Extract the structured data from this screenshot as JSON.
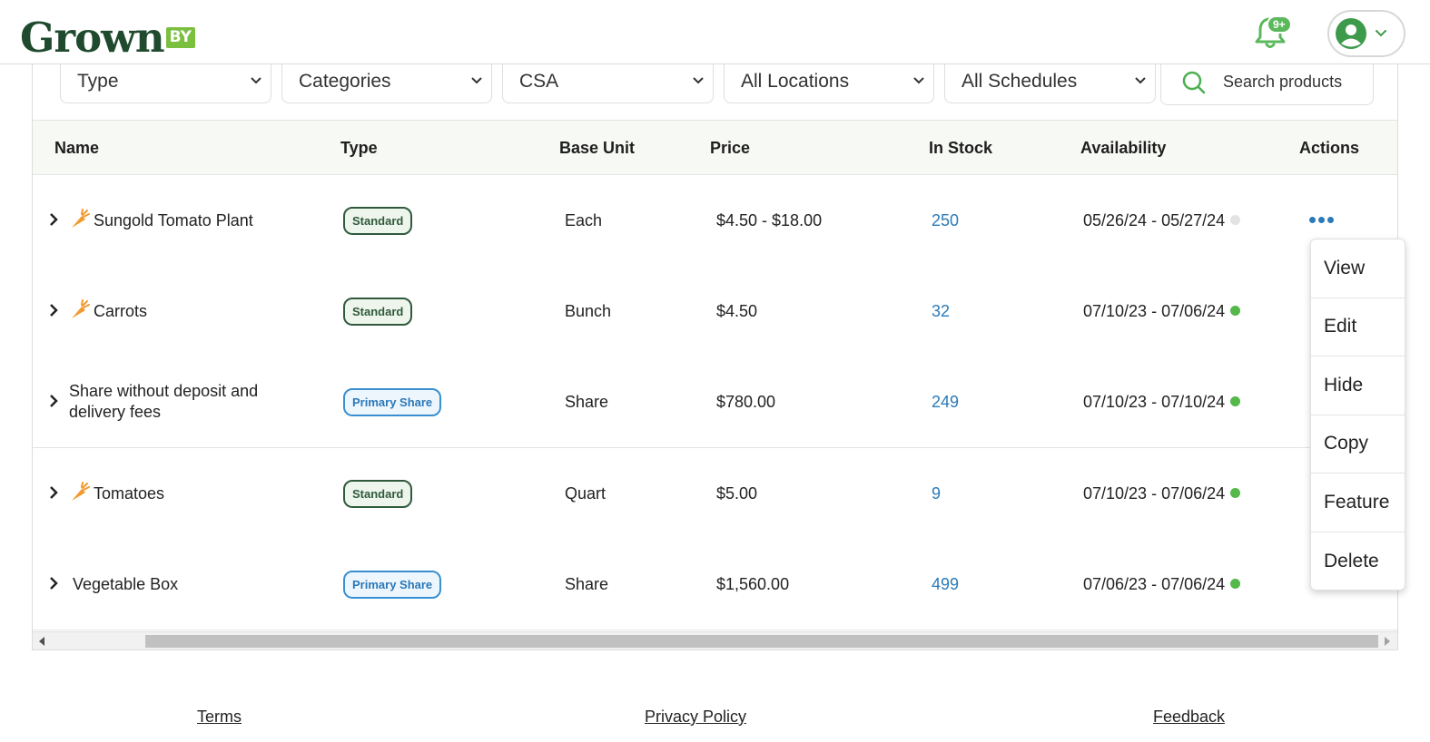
{
  "brand": {
    "logo_word": "Grown",
    "logo_suffix": "BY",
    "primary_color": "#1f4a2e",
    "accent_color": "#7bbf3f"
  },
  "header": {
    "notification_count": "9+",
    "bell_icon": "bell-icon",
    "user_icon": "user-avatar-icon"
  },
  "filters": {
    "type": "Type",
    "categories": "Categories",
    "csa": "CSA",
    "locations": "All Locations",
    "schedules": "All Schedules",
    "search_placeholder": "Search products"
  },
  "table": {
    "columns": [
      "Name",
      "Type",
      "Base Unit",
      "Price",
      "In Stock",
      "Availability",
      "Actions"
    ],
    "rows": [
      {
        "name": "Sungold Tomato Plant",
        "type": "Standard",
        "unit": "Each",
        "price": "$4.50 - $18.00",
        "stock": "250",
        "availability": "05/26/24 - 05/27/24",
        "status": "grey"
      },
      {
        "name": "Carrots",
        "type": "Standard",
        "unit": "Bunch",
        "price": "$4.50",
        "stock": "32",
        "availability": "07/10/23 - 07/06/24",
        "status": "green"
      },
      {
        "name": "Share without deposit and delivery fees",
        "type": "Primary Share",
        "unit": "Share",
        "price": "$780.00",
        "stock": "249",
        "availability": "07/10/23 - 07/10/24",
        "status": "green"
      },
      {
        "name": "Tomatoes",
        "type": "Standard",
        "unit": "Quart",
        "price": "$5.00",
        "stock": "9",
        "availability": "07/10/23 - 07/06/24",
        "status": "green"
      },
      {
        "name": "Vegetable Box",
        "type": "Primary Share",
        "unit": "Share",
        "price": "$1,560.00",
        "stock": "499",
        "availability": "07/06/23 - 07/06/24",
        "status": "green"
      }
    ]
  },
  "actions_menu": [
    "View",
    "Edit",
    "Hide",
    "Copy",
    "Feature",
    "Delete"
  ],
  "footer": {
    "terms": "Terms",
    "privacy": "Privacy Policy",
    "feedback": "Feedback"
  },
  "colors": {
    "link_blue": "#2a7ab8",
    "status_green": "#54b84a",
    "status_grey": "#e3e3e3"
  }
}
